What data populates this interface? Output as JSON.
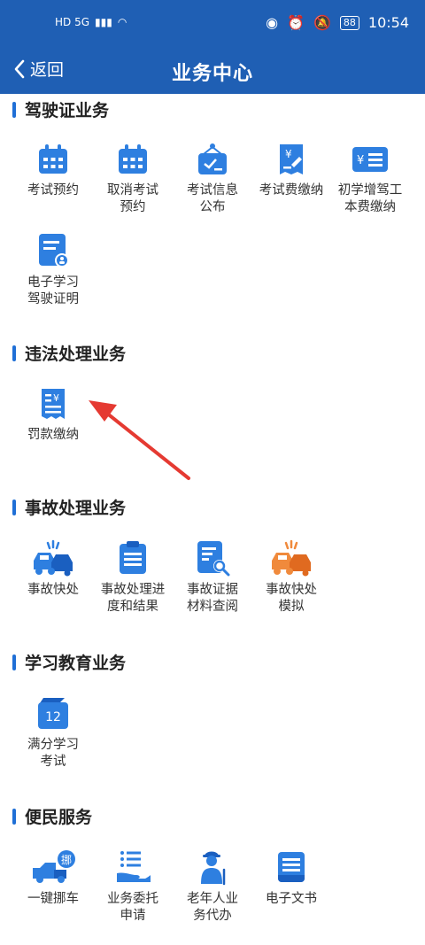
{
  "status_bar": {
    "left": "HD 5G",
    "battery": "88",
    "time": "10:54"
  },
  "nav": {
    "back_label": "返回",
    "title": "业务中心"
  },
  "sections": {
    "license": {
      "title": "驾驶证业务",
      "items": [
        "考试预约",
        "取消考试\n预约",
        "考试信息\n公布",
        "考试费缴纳",
        "初学增驾工\n本费缴纳",
        "电子学习\n驾驶证明"
      ]
    },
    "violation": {
      "title": "违法处理业务",
      "items": [
        "罚款缴纳"
      ]
    },
    "accident": {
      "title": "事故处理业务",
      "items": [
        "事故快处",
        "事故处理进\n度和结果",
        "事故证据\n材料查阅",
        "事故快处\n模拟"
      ]
    },
    "education": {
      "title": "学习教育业务",
      "items": [
        "满分学习\n考试"
      ],
      "badge": "12"
    },
    "service": {
      "title": "便民服务",
      "items": [
        "一键挪车",
        "业务委托\n申请",
        "老年人业\n务代办",
        "电子文书"
      ],
      "badge": "挪"
    }
  },
  "colors": {
    "primary": "#1f5fb4",
    "icon_blue": "#2e7fe0",
    "icon_orange": "#f08a3c",
    "arrow": "#e53a32"
  }
}
